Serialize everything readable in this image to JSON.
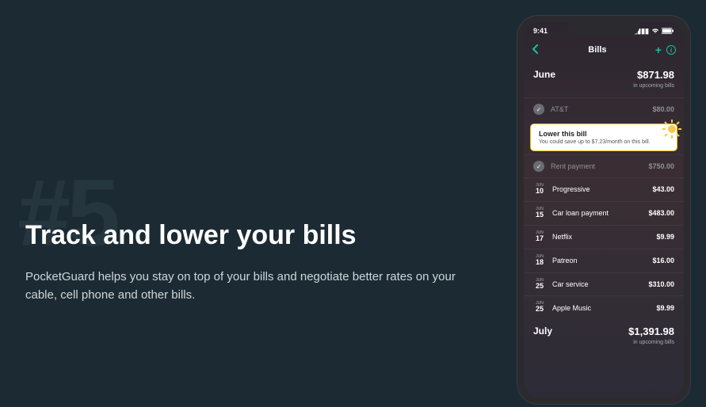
{
  "hero": {
    "number": "#5",
    "headline": "Track and lower your bills",
    "description": "PocketGuard helps you stay on top of your bills and negotiate better rates on your cable, cell phone and other bills."
  },
  "phone": {
    "status_time": "9:41",
    "topbar": {
      "title": "Bills"
    },
    "callout": {
      "title": "Lower this bill",
      "sub": "You could save up to $7.23/month on this bill."
    },
    "months": [
      {
        "label": "June",
        "amount": "$871.98",
        "sub": "in upcoming bills",
        "bills_top": [
          {
            "name": "AT&T",
            "amount": "$80.00"
          }
        ],
        "bills_rest": [
          {
            "checked": true,
            "name": "Rent payment",
            "amount": "$750.00"
          },
          {
            "date_mon": "Jun",
            "date_day": "10",
            "name": "Progressive",
            "amount": "$43.00"
          },
          {
            "date_mon": "Jun",
            "date_day": "15",
            "name": "Car loan payment",
            "amount": "$483.00"
          },
          {
            "date_mon": "Jun",
            "date_day": "17",
            "name": "Netflix",
            "amount": "$9.99"
          },
          {
            "date_mon": "Jun",
            "date_day": "18",
            "name": "Patreon",
            "amount": "$16.00"
          },
          {
            "date_mon": "Jun",
            "date_day": "25",
            "name": "Car service",
            "amount": "$310.00"
          },
          {
            "date_mon": "Jun",
            "date_day": "25",
            "name": "Apple Music",
            "amount": "$9.99"
          }
        ]
      },
      {
        "label": "July",
        "amount": "$1,391.98",
        "sub": "in upcoming bills"
      }
    ]
  }
}
